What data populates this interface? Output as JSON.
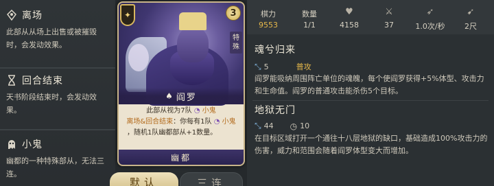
{
  "keywords": [
    {
      "icon": "leave-icon",
      "title": "离场",
      "desc": "此部从从场上出售或被摧毁时，会发动效果。"
    },
    {
      "icon": "hourglass-icon",
      "title": "回合结束",
      "desc": "天书阶段结束时，会发动效果。"
    },
    {
      "icon": "ghost-icon",
      "title": "小鬼",
      "desc": "幽都的一种特殊部从，无法三连。"
    }
  ],
  "card": {
    "cost": "3",
    "special_tag": "特殊",
    "name": "阎罗",
    "text_line1": "此部从视为7队",
    "minion_word": "小鬼",
    "trigger_label": "离场&回合结束",
    "text_line2": "：你每有1队",
    "text_line3": "，随机1队幽都部从+1数量。",
    "faction": "幽都"
  },
  "buttons": {
    "default": "默认",
    "triple": "三连"
  },
  "stats": {
    "power_label": "棋力",
    "power_value": "9553",
    "count_label": "数量",
    "count_value": "1/1",
    "hp_value": "4158",
    "atk_value": "37",
    "speed_value": "1.0次/秒",
    "range_value": "2尺"
  },
  "skills": [
    {
      "title": "魂兮归来",
      "range": "5",
      "tag": "普攻",
      "desc": "阎罗能吸纳周围阵亡单位的魂魄，每个使阎罗获得+5%体型、攻击力和生命值。阎罗的普通攻击能杀伤5个目标。"
    },
    {
      "title": "地狱无门",
      "range": "44",
      "cooldown": "10",
      "desc": "在目标区域打开一个通往十八层地狱的缺口，基础造成100%攻击力的伤害，威力和范围会随着阎罗体型变大而增加。"
    }
  ],
  "colors": {
    "gold": "#e6b84a",
    "panel": "#2b3033",
    "card_bg": "#ece3d0"
  }
}
